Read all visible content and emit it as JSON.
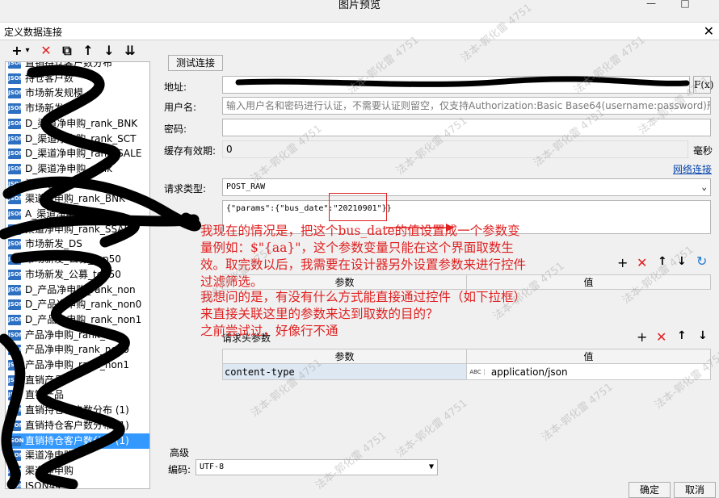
{
  "window": {
    "title": "图片预览",
    "minimize": "—",
    "maximize": "□"
  },
  "dialog": {
    "title": "定义数据连接",
    "close": "✕"
  },
  "toolbar": {
    "add": "+",
    "add_menu": "▾",
    "delete": "✕",
    "copy": "⧉",
    "up": "↑",
    "down": "↓",
    "sort": "⇊"
  },
  "tree": {
    "items": [
      "直销持仓客户数分布",
      "持仓客户数",
      "市场新发规模",
      "市场新发",
      "D_渠道净申购_rank_BNK",
      "D_渠道净申购_rank_SCT",
      "D_渠道净申购_rank_SALE",
      "D_渠道净申购_rank",
      "渠道净申购",
      "渠道净申购_rank_BNK",
      "A_渠道净申购",
      "渠道净申购_rank_SSALE",
      "市场新发_DS",
      "市场新发_公募_top50",
      "市场新发_公募_top50",
      "D_产品净申购_rank_non",
      "D_产品净申购_rank_non0",
      "D_产品净申购_rank_non1",
      "产品净申购_rank_non",
      "产品净申购_rank_non0",
      "产品净申购_rank_non1",
      "直销产品",
      "直销产品",
      "直销持仓客户数分布 (1)",
      "直销持仓客户数分布 (1)",
      "直销持仓客户数分布 (1)",
      "渠道净申购",
      "渠道净申购",
      "JSON44"
    ],
    "selected_index": 25,
    "icon": "JSON"
  },
  "form": {
    "test_button": "测试连接",
    "address_label": "地址:",
    "address_value": "",
    "fx_button": "F(x)",
    "user_label": "用户名:",
    "user_placeholder": "输入用户名和密码进行认证，不需要认证则留空，仅支持Authorization:Basic Base64(username:password)形式",
    "password_label": "密码:",
    "cache_label": "缓存有效期:",
    "cache_value": "0",
    "cache_unit": "毫秒",
    "network_link": "网络连接",
    "request_type_label": "请求类型:",
    "request_type_value": "POST_RAW",
    "body_text": "{\"params\":{\"bus_date\":\"20210901\"}}",
    "params_header_param": "参数",
    "params_header_value": "值",
    "headers_label": "请求头参数",
    "headers_col_param": "参数",
    "headers_col_value": "值",
    "header_row_key": "content-type",
    "header_row_type": "ABC",
    "header_row_value": "application/json",
    "advanced_label": "高级",
    "encoding_label": "编码:",
    "encoding_value": "UTF-8",
    "ok_button": "确定",
    "cancel_button": "取消"
  },
  "annotation": {
    "lines": [
      "我现在的情况是，把这个bus_date的值设置成一个参数变",
      "量例如：$\"{aa}\"，这个参数变量只能在这个界面取数生",
      "效。取完数以后，我需要在设计器另外设置参数来进行控件",
      "过滤筛选。",
      "我想问的是，有没有什么方式能直接通过控件（如下拉框）",
      "来直接关联这里的参数来达到取数的目的？",
      "之前尝试过，好像行不通"
    ]
  },
  "watermark": "法本-郭化雷 4751"
}
